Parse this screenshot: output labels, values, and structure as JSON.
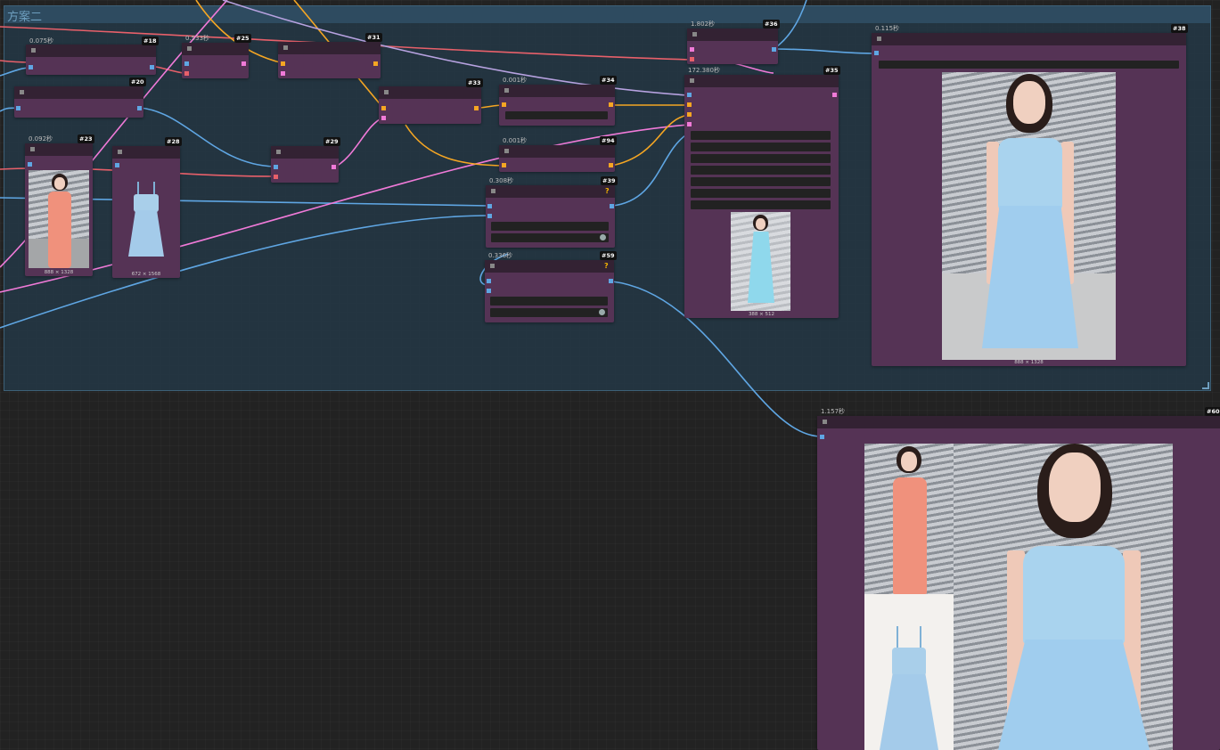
{
  "group": {
    "title": "方案二"
  },
  "nodes": [
    {
      "id": "#18",
      "time": "0.075秒"
    },
    {
      "id": "#20",
      "time": ""
    },
    {
      "id": "#23",
      "time": "0.092秒",
      "dim": "888 × 1328"
    },
    {
      "id": "#28",
      "time": "",
      "dim": "672 × 1568"
    },
    {
      "id": "#25",
      "time": "0.533秒"
    },
    {
      "id": "#31",
      "time": ""
    },
    {
      "id": "#29",
      "time": ""
    },
    {
      "id": "#33",
      "time": ""
    },
    {
      "id": "#34",
      "time": "0.001秒"
    },
    {
      "id": "#94",
      "time": "0.001秒"
    },
    {
      "id": "#39",
      "time": "0.308秒",
      "warn": "?"
    },
    {
      "id": "#59",
      "time": "0.336秒",
      "warn": "?"
    },
    {
      "id": "#36",
      "time": "1.802秒"
    },
    {
      "id": "#35",
      "time": "172.380秒",
      "dim": "388 × 512"
    },
    {
      "id": "#38",
      "time": "0.115秒",
      "dim": "888 × 1328"
    },
    {
      "id": "#60",
      "time": "1.157秒"
    }
  ],
  "colors": {
    "node_body": "#553355",
    "node_title": "#332233",
    "group_bg": "#243643",
    "wire_blue": "#5fa6e3",
    "wire_pink": "#f07ad8",
    "wire_orange": "#f5a623",
    "wire_red": "#e8606a",
    "wire_lavender": "#b7a2e0"
  }
}
